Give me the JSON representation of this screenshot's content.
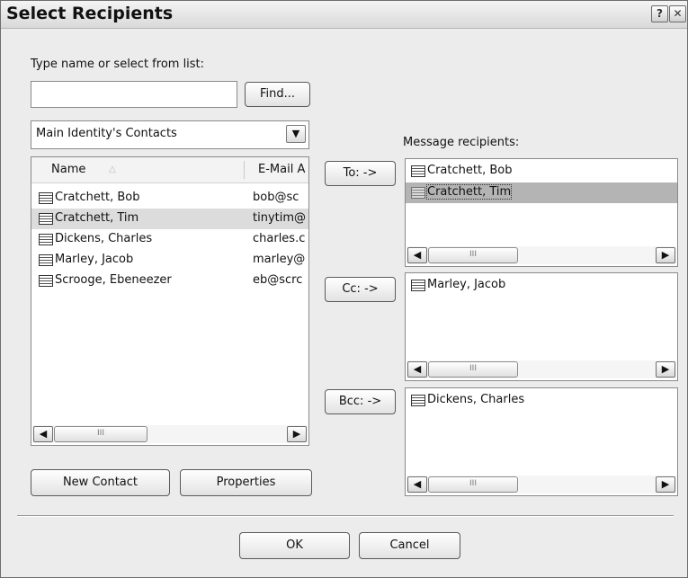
{
  "window": {
    "title": "Select Recipients",
    "help_label": "?",
    "close_label": "✕"
  },
  "search": {
    "label": "Type name or select from list:",
    "value": "",
    "find_label": "Find..."
  },
  "address_book": {
    "selected": "Main Identity's Contacts",
    "arrow": "▼"
  },
  "contacts": {
    "col_name": "Name",
    "col_email": "E-Mail A",
    "rows": [
      {
        "name": "Cratchett, Bob",
        "email": "bob@sc"
      },
      {
        "name": "Cratchett, Tim",
        "email": "tinytim@"
      },
      {
        "name": "Dickens, Charles",
        "email": "charles.c"
      },
      {
        "name": "Marley, Jacob",
        "email": "marley@"
      },
      {
        "name": "Scrooge, Ebeneezer",
        "email": "eb@scrc"
      }
    ]
  },
  "recipients": {
    "label": "Message recipients:",
    "to": {
      "button": "To: ->",
      "items": [
        "Cratchett, Bob",
        "Cratchett, Tim"
      ]
    },
    "cc": {
      "button": "Cc: ->",
      "items": [
        "Marley, Jacob"
      ]
    },
    "bcc": {
      "button": "Bcc: ->",
      "items": [
        "Dickens, Charles"
      ]
    }
  },
  "scroll": {
    "left": "◀",
    "right": "▶",
    "grip": "III"
  },
  "footer": {
    "new_contact": "New Contact",
    "properties": "Properties",
    "ok": "OK",
    "cancel": "Cancel"
  }
}
